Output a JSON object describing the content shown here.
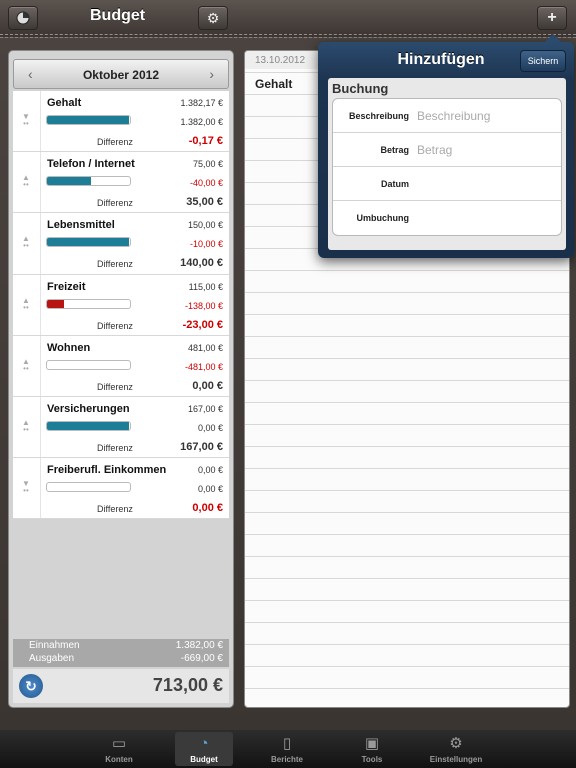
{
  "header": {
    "title": "Budget",
    "left_icon": "pie-chart-icon",
    "settings_icon": "gear-icon",
    "add_icon": "plus-icon",
    "add_label": "+"
  },
  "month_nav": {
    "prev": "‹",
    "month": "Oktober 2012",
    "next": "›"
  },
  "budget_items": [
    {
      "name": "Gehalt",
      "planned": "1.382,17 €",
      "actual": "1.382,00 €",
      "actual_color": "#333333",
      "diff_label": "Differenz",
      "diff": "-0,17 €",
      "diff_color": "#cc0000",
      "progress": 0.99,
      "bar_color": "#1f7e97",
      "arrow": "down"
    },
    {
      "name": "Telefon / Internet",
      "planned": "75,00 €",
      "actual": "-40,00 €",
      "actual_color": "#cc0000",
      "diff_label": "Differenz",
      "diff": "35,00 €",
      "diff_color": "#333333",
      "progress": 0.53,
      "bar_color": "#1f7e97",
      "arrow": "up"
    },
    {
      "name": "Lebensmittel",
      "planned": "150,00 €",
      "actual": "-10,00 €",
      "actual_color": "#cc0000",
      "diff_label": "Differenz",
      "diff": "140,00 €",
      "diff_color": "#333333",
      "progress": 0.99,
      "bar_color": "#1f7e97",
      "arrow": "up"
    },
    {
      "name": "Freizeit",
      "planned": "115,00 €",
      "actual": "-138,00 €",
      "actual_color": "#cc0000",
      "diff_label": "Differenz",
      "diff": "-23,00 €",
      "diff_color": "#cc0000",
      "progress": 0.2,
      "bar_color": "#b81414",
      "arrow": "up"
    },
    {
      "name": "Wohnen",
      "planned": "481,00 €",
      "actual": "-481,00 €",
      "actual_color": "#cc0000",
      "diff_label": "Differenz",
      "diff": "0,00 €",
      "diff_color": "#333333",
      "progress": 0,
      "bar_color": "#1f7e97",
      "arrow": "up"
    },
    {
      "name": "Versicherungen",
      "planned": "167,00 €",
      "actual": "0,00 €",
      "actual_color": "#333333",
      "diff_label": "Differenz",
      "diff": "167,00 €",
      "diff_color": "#333333",
      "progress": 0.99,
      "bar_color": "#1f7e97",
      "arrow": "up"
    },
    {
      "name": "Freiberufl. Einkommen",
      "planned": "0,00 €",
      "actual": "0,00 €",
      "actual_color": "#333333",
      "diff_label": "Differenz",
      "diff": "0,00 €",
      "diff_color": "#cc0000",
      "progress": 0,
      "bar_color": "#1f7e97",
      "arrow": "down"
    }
  ],
  "summary": {
    "income_label": "Einnahmen",
    "income": "1.382,00 €",
    "expenses_label": "Ausgaben",
    "expenses": "-669,00 €",
    "total": "713,00 €",
    "refresh_icon": "refresh-icon"
  },
  "detail": {
    "date": "13.10.2012",
    "entry": "Gehalt"
  },
  "popover": {
    "title": "Hinzufügen",
    "save_label": "Sichern",
    "section": "Buchung",
    "fields": [
      {
        "label": "Beschreibung",
        "placeholder": "Beschreibung"
      },
      {
        "label": "Betrag",
        "placeholder": "Betrag"
      },
      {
        "label": "Datum",
        "placeholder": ""
      },
      {
        "label": "Umbuchung",
        "placeholder": ""
      }
    ]
  },
  "tabs": [
    {
      "label": "Konten",
      "icon": "cards-icon",
      "active": false
    },
    {
      "label": "Budget",
      "icon": "pie-chart-icon",
      "active": true
    },
    {
      "label": "Berichte",
      "icon": "clipboard-icon",
      "active": false
    },
    {
      "label": "Tools",
      "icon": "toolbox-icon",
      "active": false
    },
    {
      "label": "Einstellungen",
      "icon": "gears-icon",
      "active": false
    }
  ],
  "colors": {
    "accent": "#1f7e97",
    "negative": "#cc0000",
    "popover": "#1d3450"
  }
}
